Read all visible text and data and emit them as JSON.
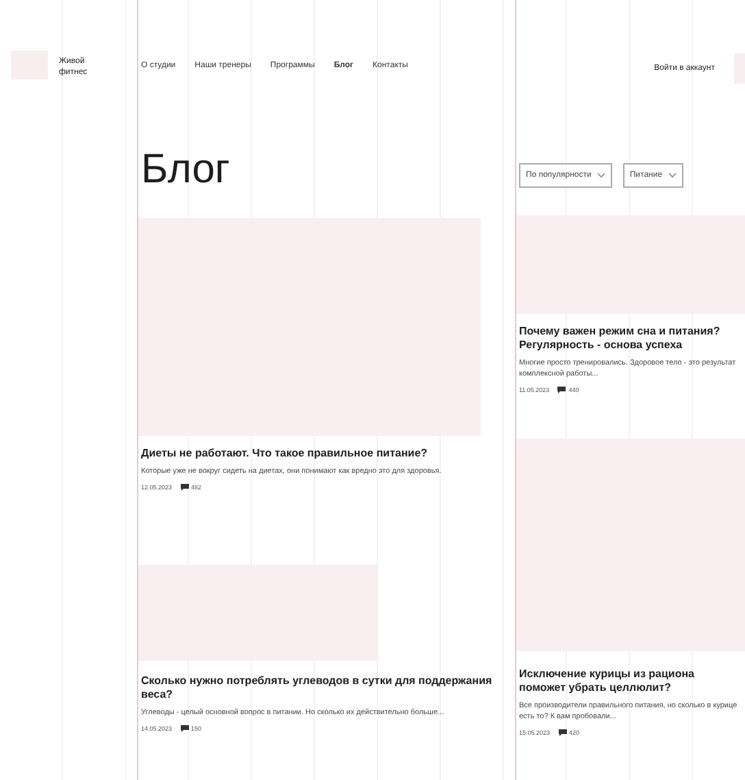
{
  "brand": {
    "name": "Живой фитнес"
  },
  "nav": [
    {
      "label": "О студии",
      "selected": false
    },
    {
      "label": "Наши тренеры",
      "selected": false
    },
    {
      "label": "Программы",
      "selected": false
    },
    {
      "label": "Блог",
      "selected": true
    },
    {
      "label": "Контакты",
      "selected": false
    }
  ],
  "login": "Войти в аккаунт",
  "page_title": "Блог",
  "filters": [
    {
      "label": "По популярности"
    },
    {
      "label": "Питание"
    }
  ],
  "columns": [
    [
      {
        "title": "Диеты не работают. Что такое правильное питание?",
        "excerpt": "Которые уже не вокруг сидеть на диетах, они понимают как вредно это для здоровья.",
        "date": "12.05.2023",
        "views": "482"
      },
      {
        "title": "Сколько нужно потреблять углеводов в сутки для поддержания веса?",
        "excerpt": "Углеводы - целый основной вопрос в питании. Но сколько их действительно больше...",
        "date": "14.05.2023",
        "views": "150"
      }
    ],
    [
      {
        "title": "Почему важен режим сна и питания? Регулярность - основа успеха",
        "excerpt": "Многие просто тренировались. Здоровое тело - это результат комплексной работы...",
        "date": "11.05.2023",
        "views": "440"
      },
      {
        "title": "Исключение курицы из рациона поможет убрать целлюлит?",
        "excerpt": "Все производители правильного питания, но сколько в курице есть то? К вам пробовали...",
        "date": "15.05.2023",
        "views": "420"
      }
    ]
  ]
}
